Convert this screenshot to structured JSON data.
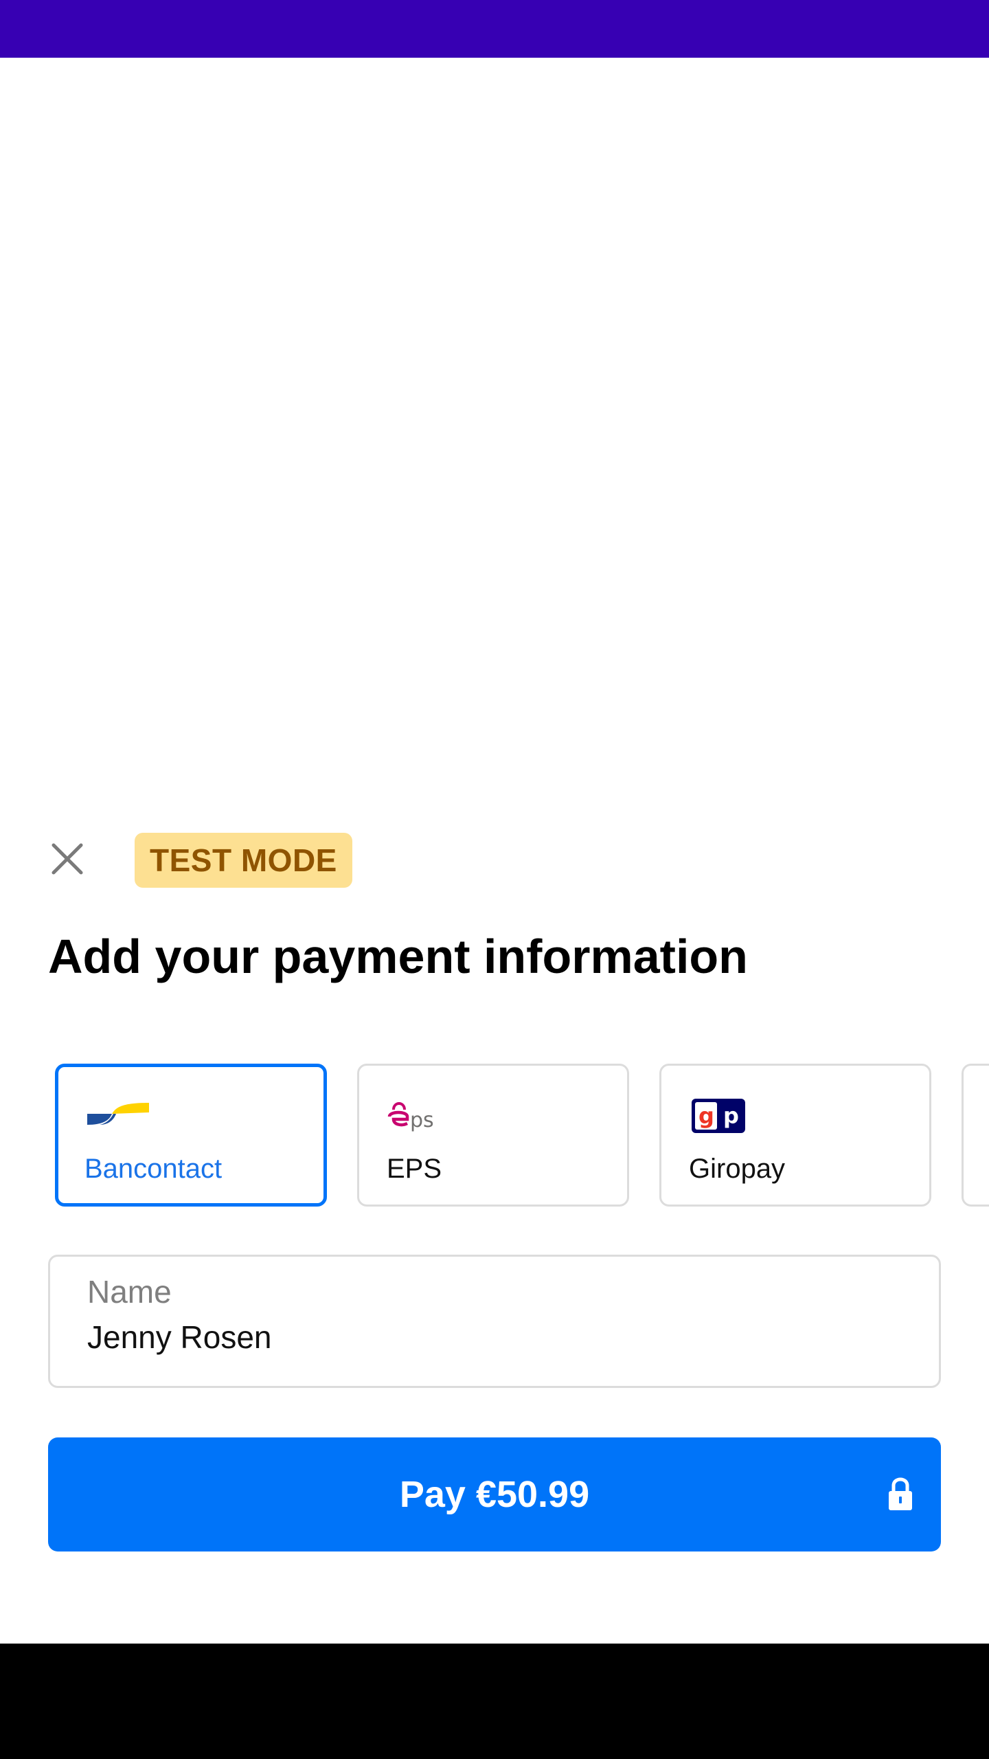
{
  "colors": {
    "status_bar": "#3700b3",
    "accent": "#0074f9",
    "badge_bg": "#fde092",
    "badge_text": "#8f5400",
    "nav_bar": "#000000"
  },
  "header": {
    "close_icon": "close-icon",
    "badge": "TEST MODE",
    "title": "Add your payment information"
  },
  "payment_methods": [
    {
      "label": "Bancontact",
      "icon": "bancontact-logo",
      "selected": true
    },
    {
      "label": "EPS",
      "icon": "eps-logo",
      "selected": false
    },
    {
      "label": "Giropay",
      "icon": "giropay-logo",
      "selected": false
    }
  ],
  "name_field": {
    "label": "Name",
    "value": "Jenny Rosen"
  },
  "pay_button": {
    "label": "Pay €50.99",
    "icon": "lock-icon"
  }
}
